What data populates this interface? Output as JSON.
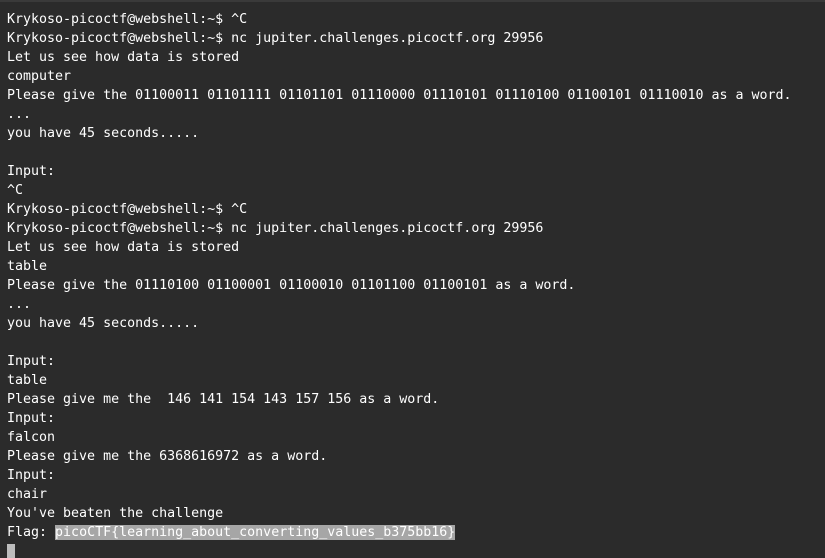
{
  "terminal": {
    "lines": [
      "Krykoso-picoctf@webshell:~$ ^C",
      "Krykoso-picoctf@webshell:~$ nc jupiter.challenges.picoctf.org 29956",
      "Let us see how data is stored",
      "computer",
      "Please give the 01100011 01101111 01101101 01110000 01110101 01110100 01100101 01110010 as a word.",
      "...",
      "you have 45 seconds.....",
      "",
      "Input:",
      "^C",
      "Krykoso-picoctf@webshell:~$ ^C",
      "Krykoso-picoctf@webshell:~$ nc jupiter.challenges.picoctf.org 29956",
      "Let us see how data is stored",
      "table",
      "Please give the 01110100 01100001 01100010 01101100 01100101 as a word.",
      "...",
      "you have 45 seconds.....",
      "",
      "Input:",
      "table",
      "Please give me the  146 141 154 143 157 156 as a word.",
      "Input:",
      "falcon",
      "Please give me the 6368616972 as a word.",
      "Input:",
      "chair",
      "You've beaten the challenge"
    ],
    "flag_prefix": "Flag: ",
    "flag_value": "picoCTF{learning_about_converting_values_b375bb16}"
  },
  "colors": {
    "background": "#2b2b2b",
    "text": "#ffffff",
    "selection": "#a6a6a6",
    "cursor": "#bdbdbd"
  }
}
